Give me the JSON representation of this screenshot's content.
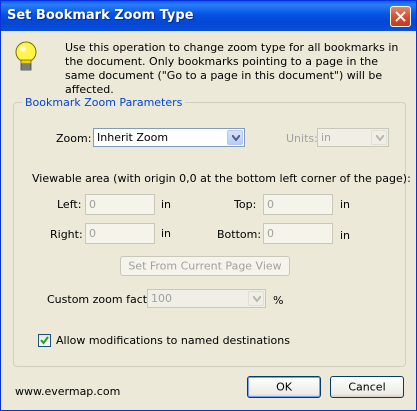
{
  "window": {
    "title": "Set Bookmark Zoom Type",
    "close_icon": "close-icon"
  },
  "intro": {
    "icon": "lightbulb-icon",
    "text": "Use this operation to change zoom type for all bookmarks in the document. Only bookmarks pointing to a page in the same document (\"Go to a page in this document\") will be affected."
  },
  "group": {
    "title": "Bookmark Zoom Parameters",
    "zoom_label": "Zoom:",
    "zoom_value": "Inherit Zoom",
    "units_label": "Units:",
    "units_value": "in",
    "viewable_label": "Viewable area (with origin 0,0 at the bottom left corner of the page):",
    "left_label": "Left:",
    "left_value": "0",
    "top_label": "Top:",
    "top_value": "0",
    "right_label": "Right:",
    "right_value": "0",
    "bottom_label": "Bottom:",
    "bottom_value": "0",
    "unit_in": "in",
    "set_from_view_label": "Set From Current Page View",
    "custom_zoom_label": "Custom zoom factor:",
    "custom_zoom_value": "100",
    "percent": "%",
    "allow_mod_label": "Allow modifications to named destinations",
    "allow_mod_checked": true
  },
  "footer": {
    "link": "www.evermap.com",
    "ok_label": "OK",
    "cancel_label": "Cancel"
  }
}
